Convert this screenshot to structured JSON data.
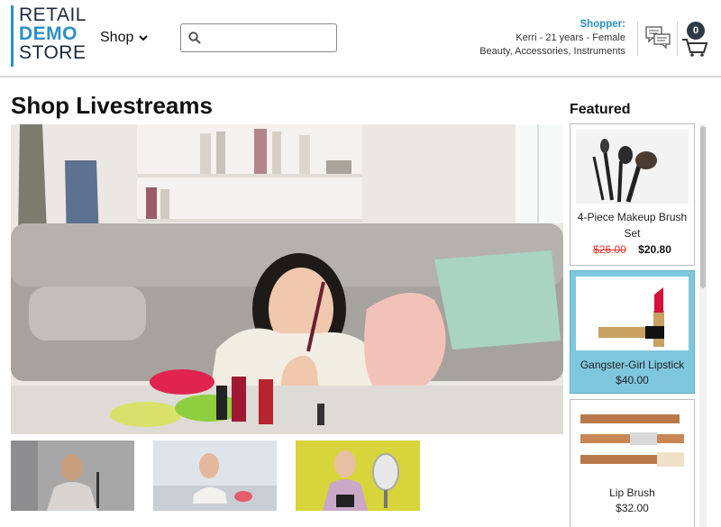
{
  "logo": {
    "line1": "RETAIL",
    "line2": "DEMO",
    "line3": "STORE"
  },
  "nav": {
    "shop_label": "Shop"
  },
  "search": {
    "placeholder": "",
    "value": ""
  },
  "shopper": {
    "label": "Shopper:",
    "details": "Kerri - 21 years - Female",
    "interests": "Beauty, Accessories, Instruments"
  },
  "cart": {
    "count": "0"
  },
  "page": {
    "title": "Shop Livestreams"
  },
  "featured": {
    "title": "Featured",
    "items": [
      {
        "name": "4-Piece Makeup Brush Set",
        "old_price": "$26.00",
        "price": "$20.80"
      },
      {
        "name": "Gangster-Girl Lipstick",
        "price": "$40.00"
      },
      {
        "name": "Lip Brush",
        "price": "$32.00"
      }
    ]
  },
  "colors": {
    "accent": "#2b90c8",
    "highlight": "#7fc7dd",
    "sale_red": "#e0322c"
  },
  "icons": [
    "search-icon",
    "chevron-down-icon",
    "chat-icon",
    "cart-icon"
  ]
}
